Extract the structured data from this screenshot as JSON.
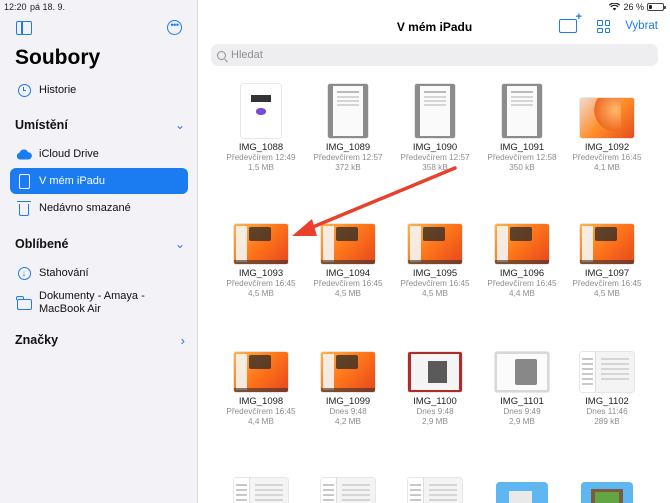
{
  "status": {
    "time": "12:20",
    "date": "pá 18. 9.",
    "battery": "26 %"
  },
  "sidebar": {
    "title": "Soubory",
    "recents_label": "Historie",
    "locations_header": "Umístění",
    "locations": [
      {
        "label": "iCloud Drive"
      },
      {
        "label": "V mém iPadu"
      },
      {
        "label": "Nedávno smazané"
      }
    ],
    "favorites_header": "Oblíbené",
    "favorites": [
      {
        "label": "Stahování"
      },
      {
        "label": "Dokumenty - Amaya - MacBook Air"
      }
    ],
    "tags_header": "Značky"
  },
  "main": {
    "title": "V mém iPadu",
    "select_label": "Vybrat",
    "search_placeholder": "Hledat"
  },
  "files": [
    {
      "name": "IMG_1088",
      "date": "Předevčírem 12:49",
      "size": "1,5 MB"
    },
    {
      "name": "IMG_1089",
      "date": "Předevčírem 12:57",
      "size": "372 kB"
    },
    {
      "name": "IMG_1090",
      "date": "Předevčírem 12:57",
      "size": "358 kB"
    },
    {
      "name": "IMG_1091",
      "date": "Předevčírem 12:58",
      "size": "350 kB"
    },
    {
      "name": "IMG_1092",
      "date": "Předevčírem 16:45",
      "size": "4,1 MB"
    },
    {
      "name": "IMG_1093",
      "date": "Předevčírem 16:45",
      "size": "4,5 MB"
    },
    {
      "name": "IMG_1094",
      "date": "Předevčírem 16:45",
      "size": "4,5 MB"
    },
    {
      "name": "IMG_1095",
      "date": "Předevčírem 16:45",
      "size": "4,5 MB"
    },
    {
      "name": "IMG_1096",
      "date": "Předevčírem 16:45",
      "size": "4,4 MB"
    },
    {
      "name": "IMG_1097",
      "date": "Předevčírem 16:45",
      "size": "4,5 MB"
    },
    {
      "name": "IMG_1098",
      "date": "Předevčírem 16:45",
      "size": "4,4 MB"
    },
    {
      "name": "IMG_1099",
      "date": "Dnes 9:48",
      "size": "4,2 MB"
    },
    {
      "name": "IMG_1100",
      "date": "Dnes 9:48",
      "size": "2,9 MB"
    },
    {
      "name": "IMG_1101",
      "date": "Dnes 9:49",
      "size": "2,9 MB"
    },
    {
      "name": "IMG_1102",
      "date": "Dnes 11:46",
      "size": "289 kB"
    }
  ]
}
